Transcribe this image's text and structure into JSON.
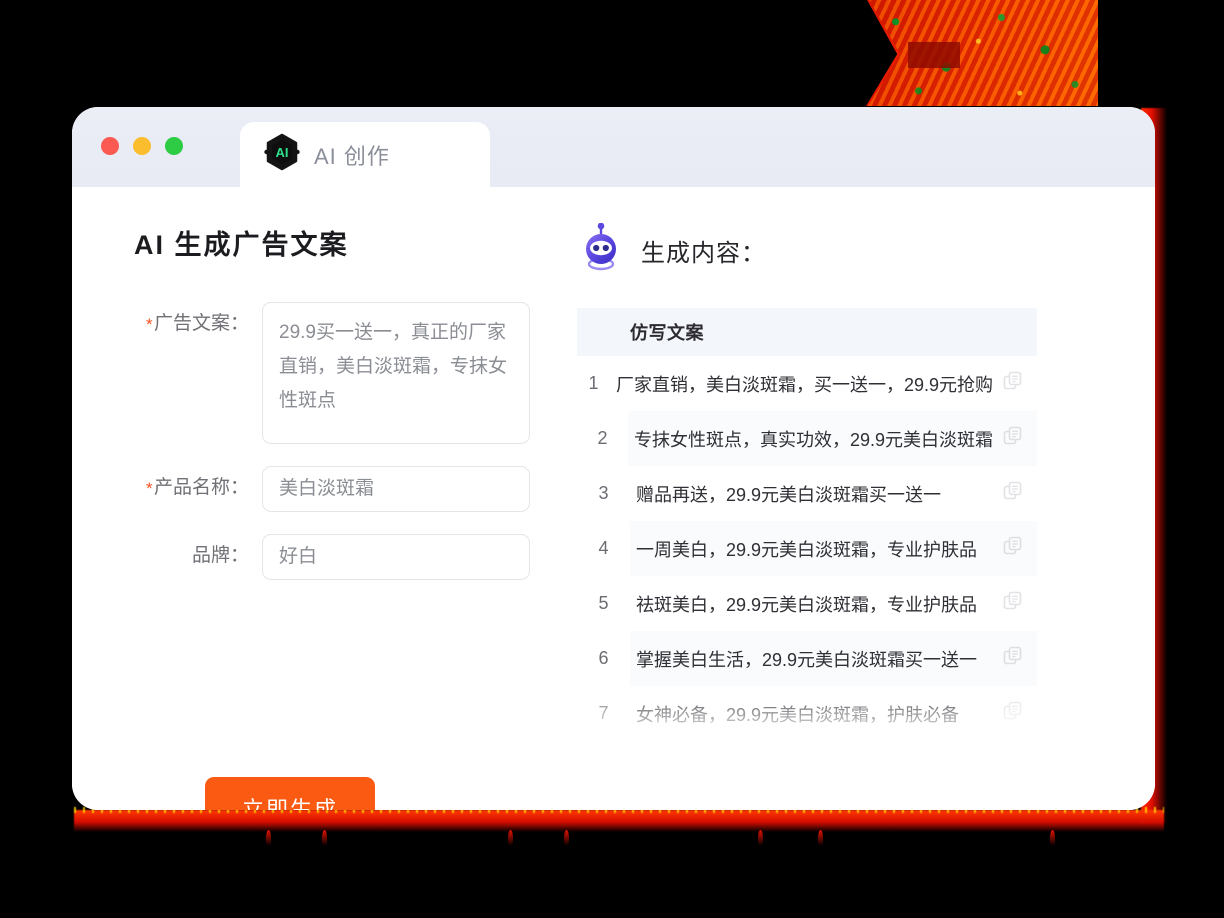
{
  "window": {
    "traffic_lights": [
      {
        "name": "close",
        "color": "#fb5a52"
      },
      {
        "name": "minimize",
        "color": "#fbbd2e"
      },
      {
        "name": "maximize",
        "color": "#2ecc45"
      }
    ],
    "tab": {
      "label": "AI 创作",
      "icon": "ai-hexagon-icon",
      "icon_text": "AI"
    }
  },
  "left": {
    "title": "AI 生成广告文案",
    "fields": [
      {
        "label": "广告文案：",
        "required": true,
        "value": "29.9买一送一，真正的厂家直销，美白淡斑霜，专抹女性斑点",
        "type": "textarea"
      },
      {
        "label": "产品名称：",
        "required": true,
        "value": "美白淡斑霜",
        "type": "input"
      },
      {
        "label": "品牌：",
        "required": false,
        "value": "好白",
        "type": "input"
      }
    ],
    "generate_button": "立即生成"
  },
  "right": {
    "icon": "robot-icon",
    "title": "生成内容：",
    "table": {
      "columns": [
        "",
        "仿写文案"
      ],
      "rows": [
        {
          "num": "1",
          "text": "厂家直销，美白淡斑霜，买一送一，29.9元抢购"
        },
        {
          "num": "2",
          "text": "专抹女性斑点，真实功效，29.9元美白淡斑霜"
        },
        {
          "num": "3",
          "text": "赠品再送，29.9元美白淡斑霜买一送一"
        },
        {
          "num": "4",
          "text": "一周美白，29.9元美白淡斑霜，专业护肤品"
        },
        {
          "num": "5",
          "text": "祛斑美白，29.9元美白淡斑霜，专业护肤品"
        },
        {
          "num": "6",
          "text": "掌握美白生活，29.9元美白淡斑霜买一送一"
        },
        {
          "num": "7",
          "text": "女神必备，29.9元美白淡斑霜，护肤必备"
        }
      ],
      "row_action_icon": "copy-icon"
    }
  },
  "colors": {
    "accent_orange": "#fb5a12",
    "required_star": "#f4511e",
    "titlebar": "#eceef6",
    "table_header": "#f3f6fb",
    "robot_purple": "#4b3fd6",
    "deco_red": "#e01200"
  }
}
